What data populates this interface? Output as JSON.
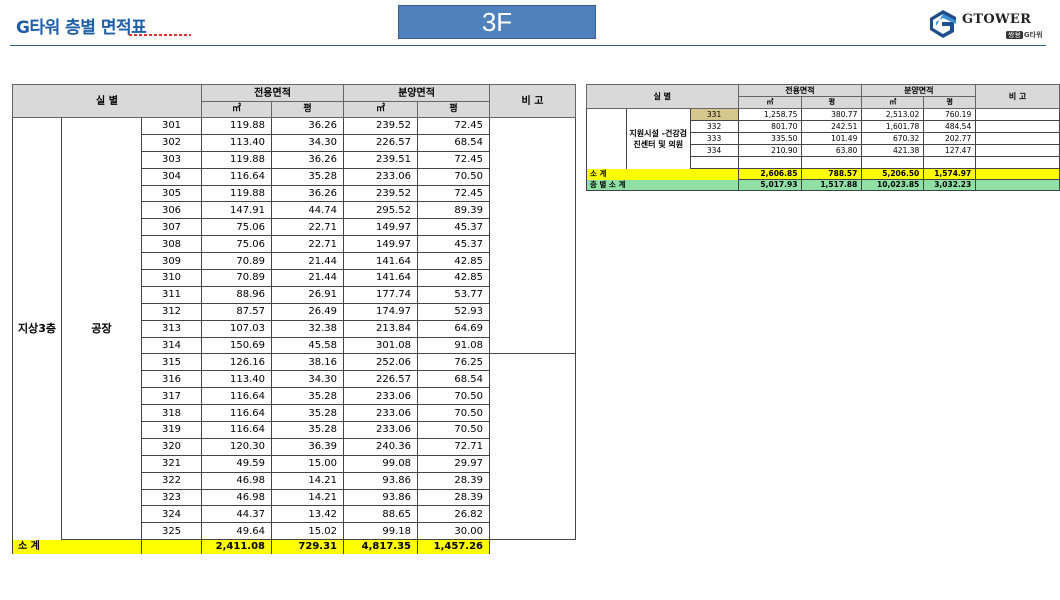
{
  "header": {
    "title": "G타워 층별 면적표",
    "floor": "3F",
    "logo_text": "GTOWER",
    "logo_sub_badge": "쌍용",
    "logo_sub_text": "G타워"
  },
  "main_table": {
    "headers": {
      "room": "실      별",
      "exclusive_area": "전용면적",
      "sale_area": "분양면적",
      "remark": "비  고",
      "unit_m2": "㎡",
      "unit_pyeong": "평"
    },
    "floor_label": "지상3층",
    "use_label": "공장",
    "rows": [
      {
        "unit": "301",
        "ex_m2": "119.88",
        "ex_py": "36.26",
        "sa_m2": "239.52",
        "sa_py": "72.45"
      },
      {
        "unit": "302",
        "ex_m2": "113.40",
        "ex_py": "34.30",
        "sa_m2": "226.57",
        "sa_py": "68.54"
      },
      {
        "unit": "303",
        "ex_m2": "119.88",
        "ex_py": "36.26",
        "sa_m2": "239.51",
        "sa_py": "72.45"
      },
      {
        "unit": "304",
        "ex_m2": "116.64",
        "ex_py": "35.28",
        "sa_m2": "233.06",
        "sa_py": "70.50"
      },
      {
        "unit": "305",
        "ex_m2": "119.88",
        "ex_py": "36.26",
        "sa_m2": "239.52",
        "sa_py": "72.45"
      },
      {
        "unit": "306",
        "ex_m2": "147.91",
        "ex_py": "44.74",
        "sa_m2": "295.52",
        "sa_py": "89.39"
      },
      {
        "unit": "307",
        "ex_m2": "75.06",
        "ex_py": "22.71",
        "sa_m2": "149.97",
        "sa_py": "45.37"
      },
      {
        "unit": "308",
        "ex_m2": "75.06",
        "ex_py": "22.71",
        "sa_m2": "149.97",
        "sa_py": "45.37"
      },
      {
        "unit": "309",
        "ex_m2": "70.89",
        "ex_py": "21.44",
        "sa_m2": "141.64",
        "sa_py": "42.85"
      },
      {
        "unit": "310",
        "ex_m2": "70.89",
        "ex_py": "21.44",
        "sa_m2": "141.64",
        "sa_py": "42.85"
      },
      {
        "unit": "311",
        "ex_m2": "88.96",
        "ex_py": "26.91",
        "sa_m2": "177.74",
        "sa_py": "53.77"
      },
      {
        "unit": "312",
        "ex_m2": "87.57",
        "ex_py": "26.49",
        "sa_m2": "174.97",
        "sa_py": "52.93"
      },
      {
        "unit": "313",
        "ex_m2": "107.03",
        "ex_py": "32.38",
        "sa_m2": "213.84",
        "sa_py": "64.69"
      },
      {
        "unit": "314",
        "ex_m2": "150.69",
        "ex_py": "45.58",
        "sa_m2": "301.08",
        "sa_py": "91.08"
      },
      {
        "unit": "315",
        "ex_m2": "126.16",
        "ex_py": "38.16",
        "sa_m2": "252.06",
        "sa_py": "76.25"
      },
      {
        "unit": "316",
        "ex_m2": "113.40",
        "ex_py": "34.30",
        "sa_m2": "226.57",
        "sa_py": "68.54"
      },
      {
        "unit": "317",
        "ex_m2": "116.64",
        "ex_py": "35.28",
        "sa_m2": "233.06",
        "sa_py": "70.50"
      },
      {
        "unit": "318",
        "ex_m2": "116.64",
        "ex_py": "35.28",
        "sa_m2": "233.06",
        "sa_py": "70.50"
      },
      {
        "unit": "319",
        "ex_m2": "116.64",
        "ex_py": "35.28",
        "sa_m2": "233.06",
        "sa_py": "70.50"
      },
      {
        "unit": "320",
        "ex_m2": "120.30",
        "ex_py": "36.39",
        "sa_m2": "240.36",
        "sa_py": "72.71"
      },
      {
        "unit": "321",
        "ex_m2": "49.59",
        "ex_py": "15.00",
        "sa_m2": "99.08",
        "sa_py": "29.97"
      },
      {
        "unit": "322",
        "ex_m2": "46.98",
        "ex_py": "14.21",
        "sa_m2": "93.86",
        "sa_py": "28.39"
      },
      {
        "unit": "323",
        "ex_m2": "46.98",
        "ex_py": "14.21",
        "sa_m2": "93.86",
        "sa_py": "28.39"
      },
      {
        "unit": "324",
        "ex_m2": "44.37",
        "ex_py": "13.42",
        "sa_m2": "88.65",
        "sa_py": "26.82"
      },
      {
        "unit": "325",
        "ex_m2": "49.64",
        "ex_py": "15.02",
        "sa_m2": "99.18",
        "sa_py": "30.00"
      }
    ],
    "subtotal": {
      "label": "소  계",
      "ex_m2": "2,411.08",
      "ex_py": "729.31",
      "sa_m2": "4,817.35",
      "sa_py": "1,457.26"
    }
  },
  "side_table": {
    "headers": {
      "room": "실      별",
      "exclusive_area": "전용면적",
      "sale_area": "분양면적",
      "remark": "비  고",
      "unit_m2": "㎡",
      "unit_pyeong": "평"
    },
    "use_label": "지원시설 -건강검진센터 및 의원",
    "rows": [
      {
        "unit": "331",
        "ex_m2": "1,258.75",
        "ex_py": "380.77",
        "sa_m2": "2,513.02",
        "sa_py": "760.19"
      },
      {
        "unit": "332",
        "ex_m2": "801.70",
        "ex_py": "242.51",
        "sa_m2": "1,601.78",
        "sa_py": "484.54"
      },
      {
        "unit": "333",
        "ex_m2": "335.50",
        "ex_py": "101.49",
        "sa_m2": "670.32",
        "sa_py": "202.77"
      },
      {
        "unit": "334",
        "ex_m2": "210.90",
        "ex_py": "63.80",
        "sa_m2": "421.38",
        "sa_py": "127.47"
      }
    ],
    "subtotal": {
      "label": "소  계",
      "ex_m2": "2,606.85",
      "ex_py": "788.57",
      "sa_m2": "5,206.50",
      "sa_py": "1,574.97"
    },
    "total": {
      "label": "층 별 소 계",
      "ex_m2": "5,017.93",
      "ex_py": "1,517.88",
      "sa_m2": "10,023.85",
      "sa_py": "3,032.23"
    }
  }
}
